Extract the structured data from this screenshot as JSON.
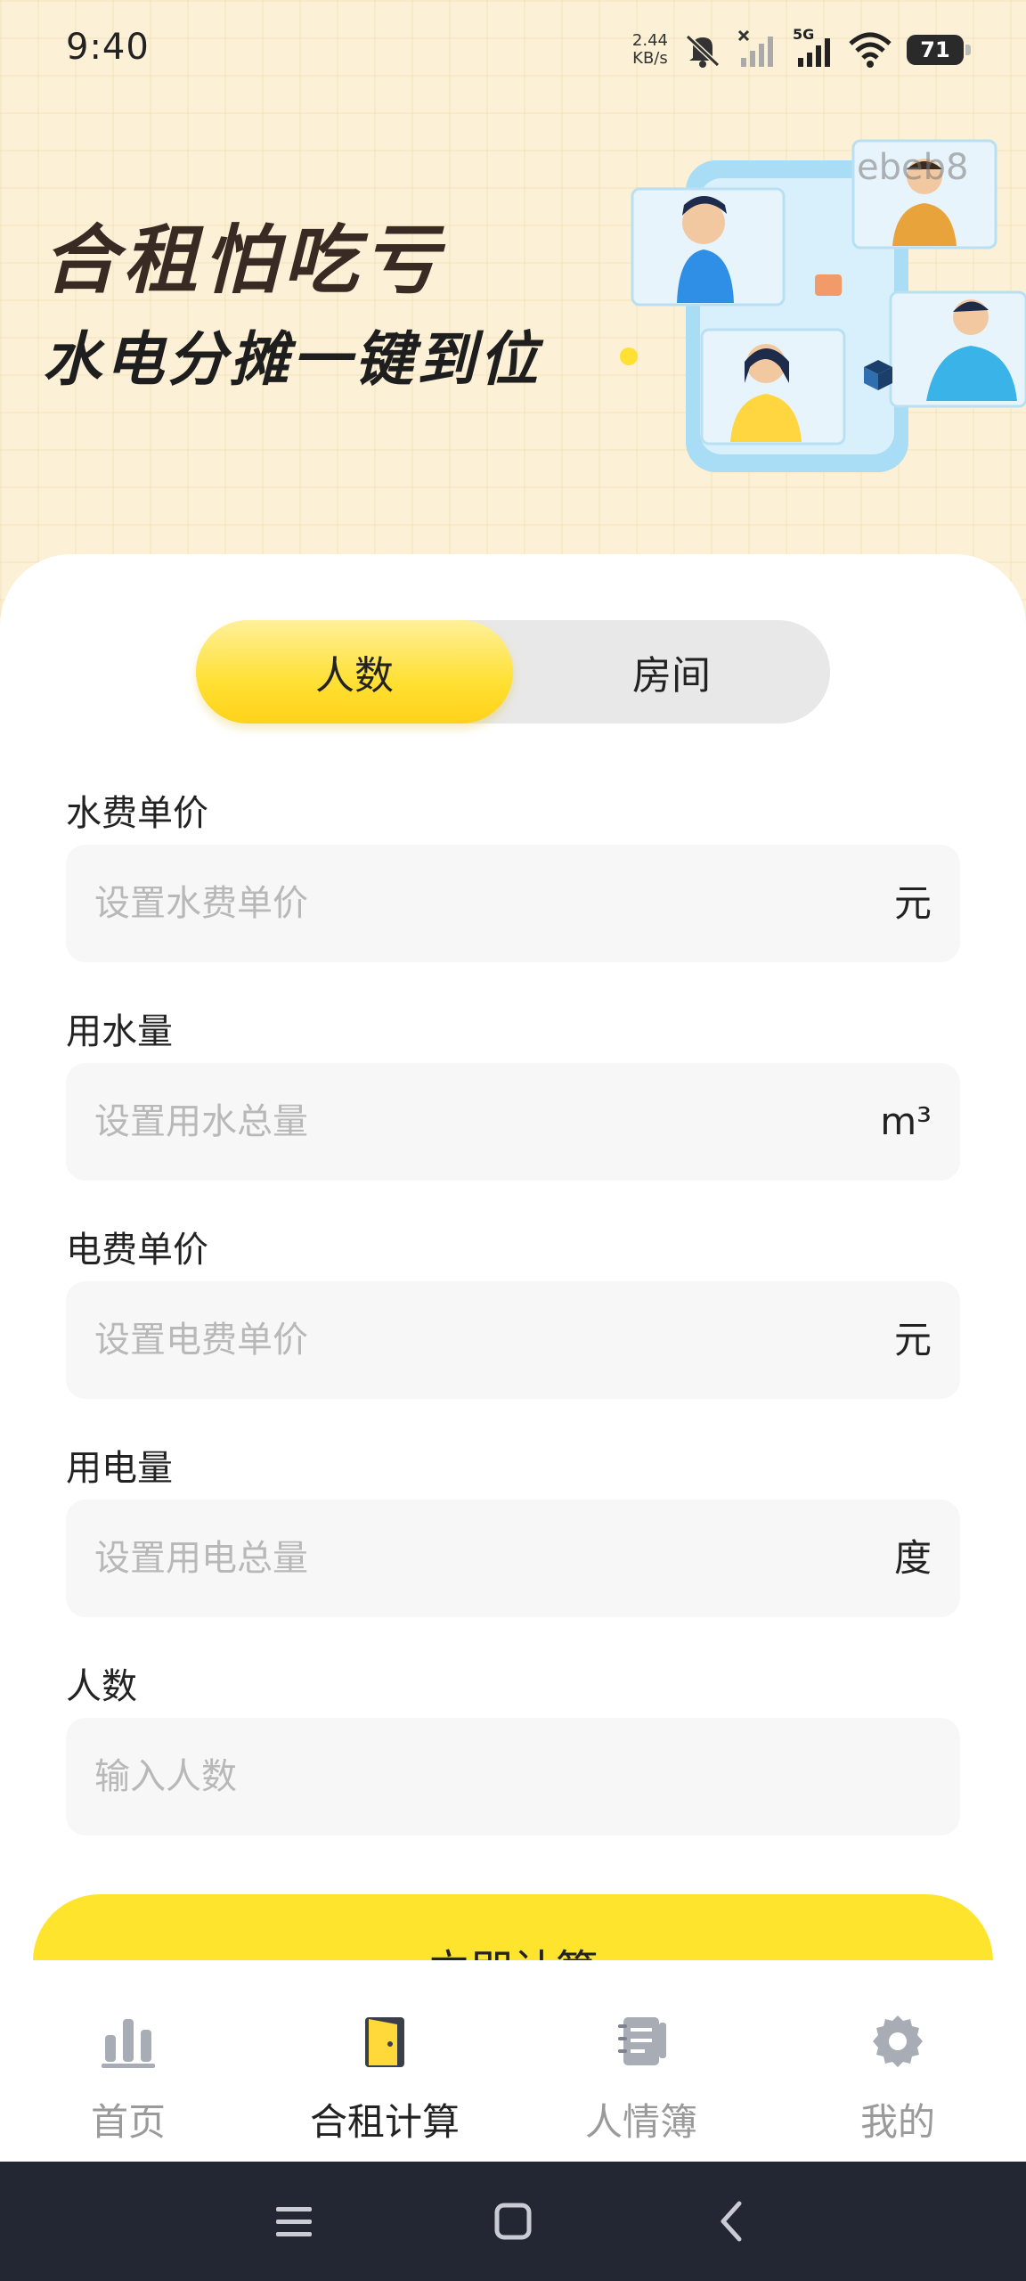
{
  "status_bar": {
    "time": "9:40",
    "speed_value": "2.44",
    "speed_unit": "KB/s",
    "network": "5G",
    "battery": "71"
  },
  "banner": {
    "title": "合租怕吃亏",
    "subtitle": "水电分摊一键到位",
    "watermark": "ebeb8"
  },
  "mode_toggle": {
    "options": [
      "人数",
      "房间"
    ],
    "selected": "人数"
  },
  "form": {
    "fields": [
      {
        "label": "水费单价",
        "placeholder": "设置水费单价",
        "unit": "元"
      },
      {
        "label": "用水量",
        "placeholder": "设置用水总量",
        "unit": "m³"
      },
      {
        "label": "电费单价",
        "placeholder": "设置电费单价",
        "unit": "元"
      },
      {
        "label": "用电量",
        "placeholder": "设置用电总量",
        "unit": "度"
      },
      {
        "label": "人数",
        "placeholder": "输入人数",
        "unit": ""
      }
    ],
    "submit_label": "立即计算"
  },
  "tab_bar": {
    "items": [
      {
        "label": "首页",
        "icon": "bar-chart-icon"
      },
      {
        "label": "合租计算",
        "icon": "door-icon"
      },
      {
        "label": "人情簿",
        "icon": "notebook-icon"
      },
      {
        "label": "我的",
        "icon": "gear-icon"
      }
    ],
    "active": "合租计算"
  },
  "colors": {
    "accent": "#FFE42E",
    "hero_bg": "#FCF0D6",
    "navbar": "#222733",
    "field_bg": "#F7F7F7"
  }
}
